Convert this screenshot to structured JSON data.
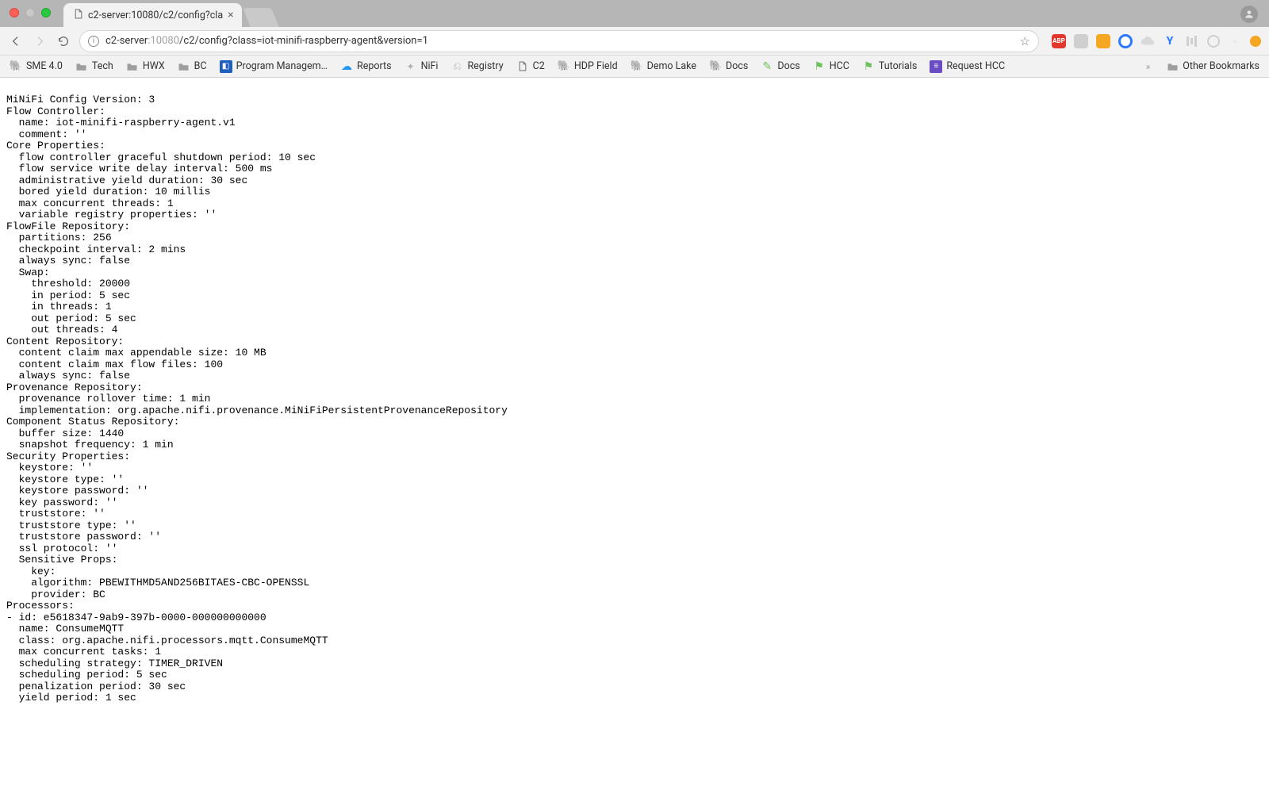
{
  "window": {
    "tab_title": "c2-server:10080/c2/config?cla",
    "url_dim_left": "c2-server",
    "url_dim_port": ":10080",
    "url_path": "/c2/config?class=iot-minifi-raspberry-agent&version=1"
  },
  "bookmarks": [
    {
      "label": "SME 4.0",
      "icon": "eleph-green"
    },
    {
      "label": "Tech",
      "icon": "folder"
    },
    {
      "label": "HWX",
      "icon": "folder"
    },
    {
      "label": "BC",
      "icon": "folder"
    },
    {
      "label": "Program Managem…",
      "icon": "pm"
    },
    {
      "label": "Reports",
      "icon": "rep"
    },
    {
      "label": "NiFi",
      "icon": "nifi"
    },
    {
      "label": "Registry",
      "icon": "reg"
    },
    {
      "label": "C2",
      "icon": "file"
    },
    {
      "label": "HDP Field",
      "icon": "eleph-grey"
    },
    {
      "label": "Demo Lake",
      "icon": "eleph-grey"
    },
    {
      "label": "Docs",
      "icon": "eleph-green"
    },
    {
      "label": "Docs",
      "icon": "docs2"
    },
    {
      "label": "HCC",
      "icon": "hcc"
    },
    {
      "label": "Tutorials",
      "icon": "tut"
    },
    {
      "label": "Request HCC",
      "icon": "list"
    }
  ],
  "other_bookmarks_label": "Other Bookmarks",
  "body_text": "MiNiFi Config Version: 3\nFlow Controller:\n  name: iot-minifi-raspberry-agent.v1\n  comment: ''\nCore Properties:\n  flow controller graceful shutdown period: 10 sec\n  flow service write delay interval: 500 ms\n  administrative yield duration: 30 sec\n  bored yield duration: 10 millis\n  max concurrent threads: 1\n  variable registry properties: ''\nFlowFile Repository:\n  partitions: 256\n  checkpoint interval: 2 mins\n  always sync: false\n  Swap:\n    threshold: 20000\n    in period: 5 sec\n    in threads: 1\n    out period: 5 sec\n    out threads: 4\nContent Repository:\n  content claim max appendable size: 10 MB\n  content claim max flow files: 100\n  always sync: false\nProvenance Repository:\n  provenance rollover time: 1 min\n  implementation: org.apache.nifi.provenance.MiNiFiPersistentProvenanceRepository\nComponent Status Repository:\n  buffer size: 1440\n  snapshot frequency: 1 min\nSecurity Properties:\n  keystore: ''\n  keystore type: ''\n  keystore password: ''\n  key password: ''\n  truststore: ''\n  truststore type: ''\n  truststore password: ''\n  ssl protocol: ''\n  Sensitive Props:\n    key:\n    algorithm: PBEWITHMD5AND256BITAES-CBC-OPENSSL\n    provider: BC\nProcessors:\n- id: e5618347-9ab9-397b-0000-000000000000\n  name: ConsumeMQTT\n  class: org.apache.nifi.processors.mqtt.ConsumeMQTT\n  max concurrent tasks: 1\n  scheduling strategy: TIMER_DRIVEN\n  scheduling period: 5 sec\n  penalization period: 30 sec\n  yield period: 1 sec"
}
